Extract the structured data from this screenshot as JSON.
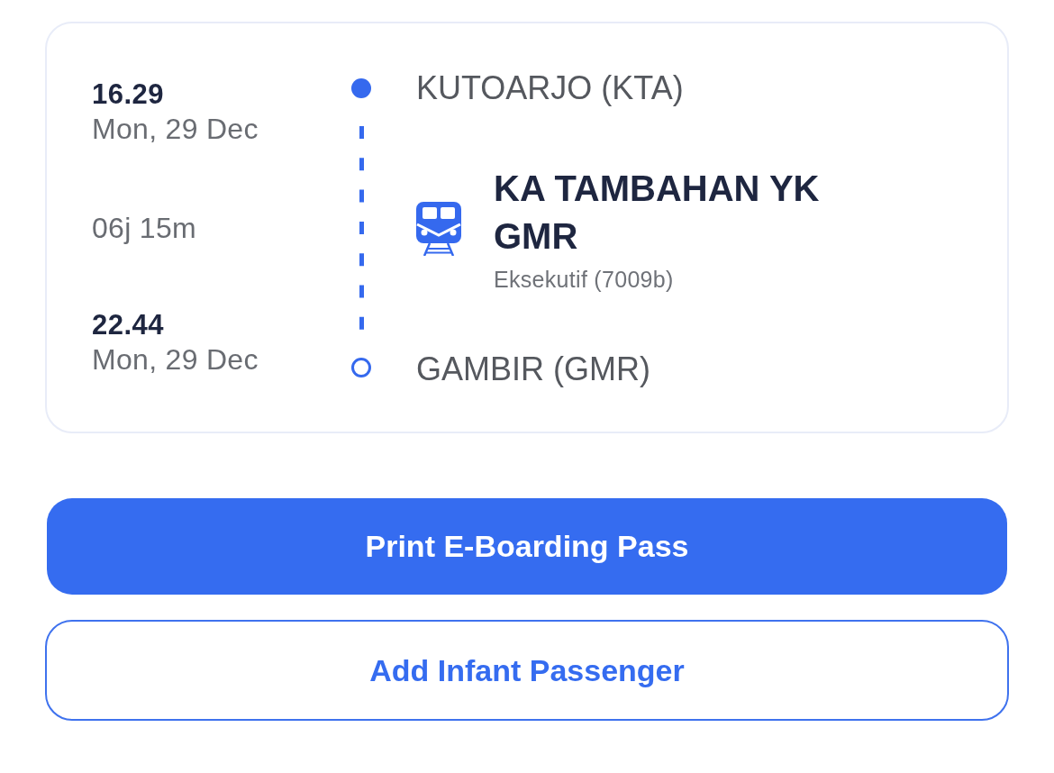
{
  "journey": {
    "stops": [
      {
        "kind": "origin",
        "time": "16.29",
        "date": "Mon, 29 Dec",
        "station": "KUTOARJO (KTA)"
      },
      {
        "kind": "destination",
        "time": "22.44",
        "date": "Mon, 29 Dec",
        "station": "GAMBIR (GMR)"
      }
    ],
    "duration": "06j 15m",
    "train": {
      "name": "KA TAMBAHAN YK GMR",
      "class": "Eksekutif (7009b)"
    }
  },
  "buttons": [
    {
      "kind": "primary",
      "label": "Print E-Boarding Pass"
    },
    {
      "kind": "outline",
      "label": "Add Infant Passenger"
    }
  ]
}
